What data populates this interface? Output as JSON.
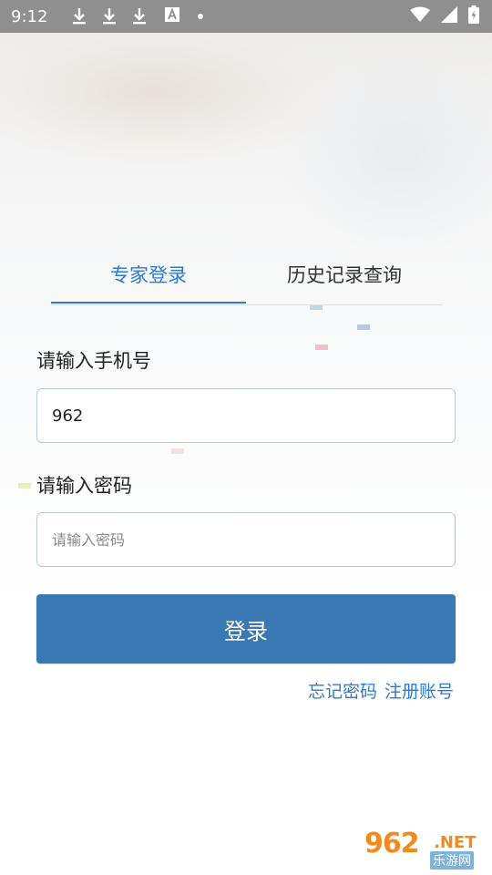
{
  "status_bar": {
    "time": "9:12",
    "icons": [
      "download-icon",
      "download-icon",
      "download-icon",
      "font-a-icon",
      "dot-icon",
      "wifi-icon",
      "signal-icon",
      "battery-charging-icon"
    ]
  },
  "tabs": [
    {
      "label": "专家登录",
      "active": true
    },
    {
      "label": "历史记录查询",
      "active": false
    }
  ],
  "form": {
    "phone_label": "请输入手机号",
    "phone_value": "962",
    "password_label": "请输入密码",
    "password_placeholder": "请输入密码",
    "login_button": "登录",
    "forgot_password": "忘记密码",
    "register": "注册账号"
  },
  "colors": {
    "accent": "#2a7bd1",
    "button": "#3a78b4",
    "status_bar": "#8f8f8f"
  },
  "watermark": {
    "brand_number": "962",
    "brand_suffix": ".NET",
    "brand_cn": "乐游网"
  }
}
